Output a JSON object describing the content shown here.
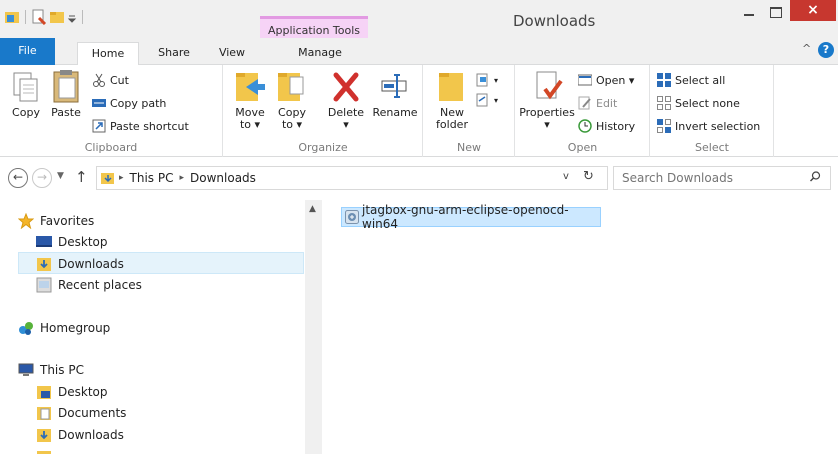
{
  "window": {
    "title": "Downloads",
    "context_tab_group": "Application Tools",
    "close_glyph": "×"
  },
  "tabs": {
    "file": "File",
    "home": "Home",
    "share": "Share",
    "view": "View",
    "manage": "Manage",
    "ribbon_toggle": "^",
    "help": "?"
  },
  "ribbon": {
    "clipboard": {
      "label": "Clipboard",
      "copy": "Copy",
      "paste": "Paste",
      "cut": "Cut",
      "copy_path": "Copy path",
      "paste_shortcut": "Paste shortcut"
    },
    "organize": {
      "label": "Organize",
      "move_to_1": "Move",
      "move_to_2": "to ▾",
      "copy_to_1": "Copy",
      "copy_to_2": "to ▾",
      "delete": "Delete",
      "delete_arrow": "▾",
      "rename": "Rename"
    },
    "new": {
      "label": "New",
      "new_folder_1": "New",
      "new_folder_2": "folder"
    },
    "open": {
      "label": "Open",
      "properties": "Properties",
      "properties_arrow": "▾",
      "open": "Open ▾",
      "edit": "Edit",
      "history": "History"
    },
    "select": {
      "label": "Select",
      "select_all": "Select all",
      "select_none": "Select none",
      "invert_selection": "Invert selection"
    }
  },
  "address": {
    "crumbs": [
      "This PC",
      "Downloads"
    ],
    "separator": "▸",
    "dropdown": "v",
    "refresh": "↻"
  },
  "search": {
    "placeholder": "Search Downloads"
  },
  "nav_pane": {
    "favorites": "Favorites",
    "favorites_items": [
      "Desktop",
      "Downloads",
      "Recent places"
    ],
    "homegroup": "Homegroup",
    "this_pc": "This PC",
    "this_pc_items": [
      "Desktop",
      "Documents",
      "Downloads"
    ]
  },
  "content": {
    "files": [
      {
        "name": "jtagbox-gnu-arm-eclipse-openocd-win64",
        "selected": true
      }
    ]
  },
  "colors": {
    "file_tab": "#1979ca",
    "context_tab": "#f6d3f6",
    "close_button": "#c7372f",
    "selection": "#cce8ff",
    "folder": "#f2c64b"
  }
}
